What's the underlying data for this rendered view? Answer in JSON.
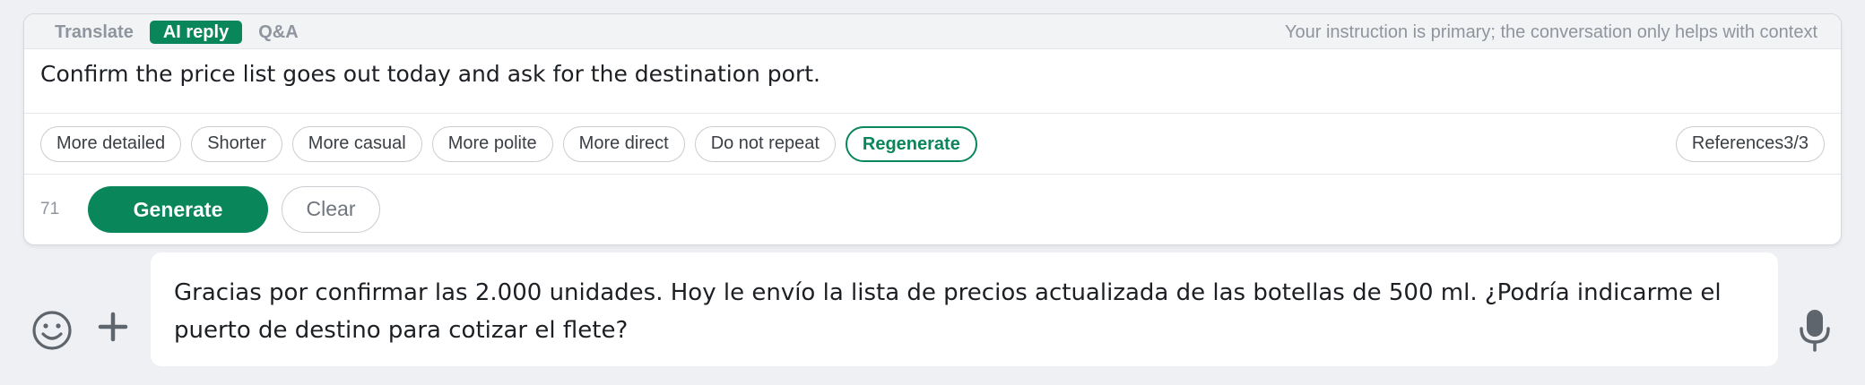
{
  "tabs": [
    {
      "label": "Translate",
      "active": false
    },
    {
      "label": "AI reply",
      "active": true
    },
    {
      "label": "Q&A",
      "active": false
    }
  ],
  "header_hint": "Your instruction is primary; the conversation only helps with context",
  "instruction": "Confirm the price list goes out today and ask for the destination port.",
  "chips": [
    {
      "label": "More detailed"
    },
    {
      "label": "Shorter"
    },
    {
      "label": "More casual"
    },
    {
      "label": "More polite"
    },
    {
      "label": "More direct"
    },
    {
      "label": "Do not repeat"
    },
    {
      "label": "Regenerate"
    }
  ],
  "references_label": "References3/3",
  "char_count": "71",
  "generate_label": "Generate",
  "clear_label": "Clear",
  "compose_text": "Gracias por confirmar las 2.000 unidades. Hoy le envío la lista de precios actualizada de las botellas de 500 ml. ¿Podría indicarme el puerto de destino para cotizar el flete?",
  "icons": {
    "emoji": "emoji-icon",
    "plus": "plus-icon",
    "mic": "microphone-icon"
  },
  "colors": {
    "accent": "#09875b",
    "muted_text": "#8f959e",
    "background": "#eef0f3"
  }
}
